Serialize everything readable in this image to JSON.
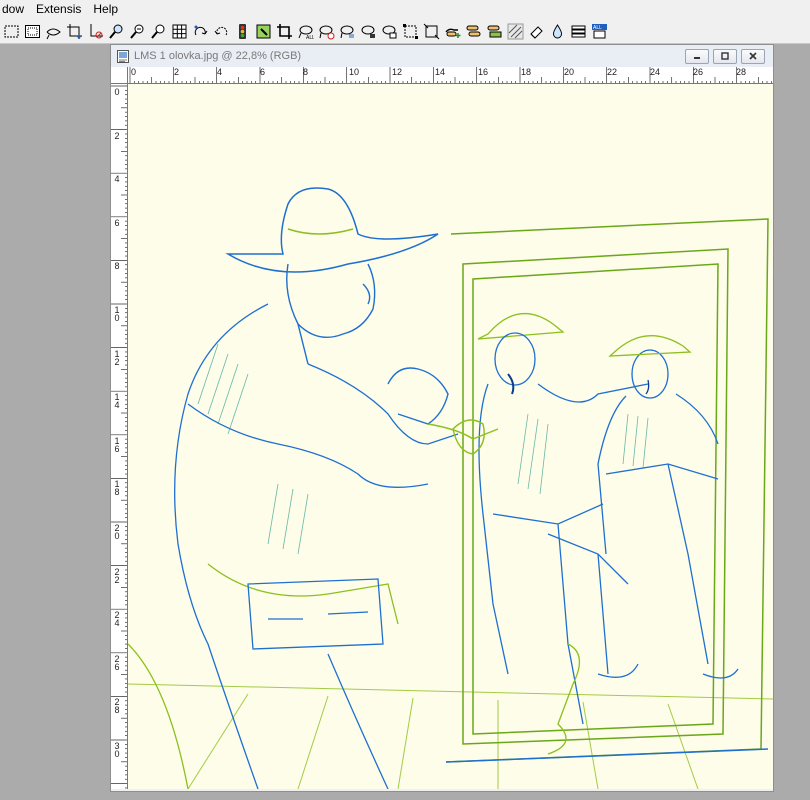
{
  "menubar": {
    "items": [
      "dow",
      "Extensis",
      "Help"
    ]
  },
  "toolbar": {
    "tools": [
      "rect-select-icon",
      "marquee-icon",
      "lasso-icon",
      "crop-line-icon",
      "line-erase-icon",
      "zoom-in-icon",
      "zoom-out-icon",
      "zoom-icon",
      "grid-icon",
      "rotate-cw-icon",
      "rotate-ccw-icon",
      "traffic-light-icon",
      "bucket-icon",
      "crop-icon",
      "lasso-select-icon",
      "lasso-delete-icon",
      "lasso-swap-icon",
      "lasso-fill-icon",
      "lasso-copy-icon",
      "transform-icon",
      "resize-icon",
      "hand-add-icon",
      "hand-stack-icon",
      "hand-paint-icon",
      "hatch-icon",
      "eraser-icon",
      "drop-icon",
      "layers-icon",
      "all-select-icon"
    ]
  },
  "document": {
    "title": "LMS 1 olovka.jpg @ 22,8% (RGB)",
    "ruler_h_labels": [
      "0",
      "2",
      "4",
      "6",
      "8",
      "10",
      "12",
      "14",
      "16",
      "18",
      "20",
      "22",
      "24",
      "26",
      "28"
    ],
    "ruler_v_labels": [
      "0",
      "2",
      "4",
      "6",
      "8",
      "10",
      "12",
      "14",
      "16",
      "18",
      "20",
      "22",
      "24",
      "26",
      "28",
      "30"
    ],
    "colors": {
      "canvas_bg": "#fdfde9",
      "ink_blue": "#1f6fd0",
      "ink_green": "#8cbf1f",
      "ink_teal": "#2a9a8a"
    }
  }
}
